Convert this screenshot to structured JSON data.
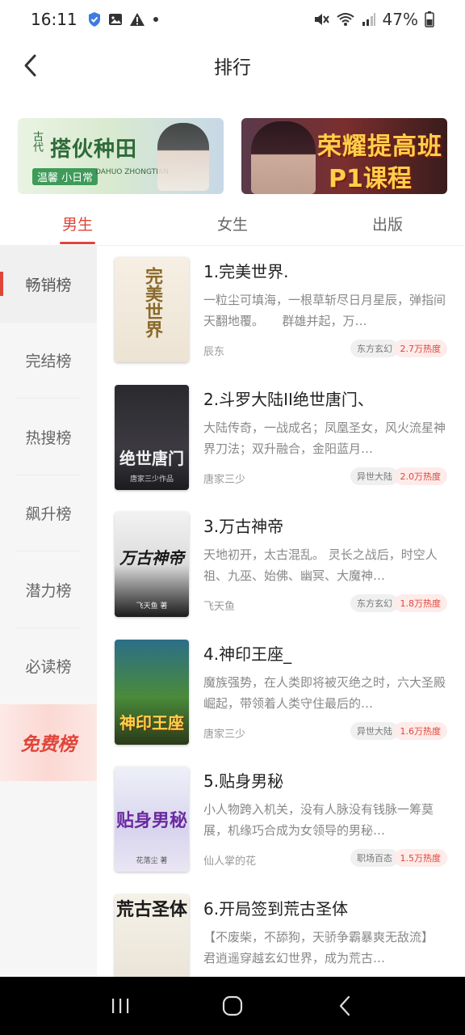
{
  "status_bar": {
    "time": "16:11",
    "battery": "47%",
    "left_icons": [
      "shield-icon",
      "image-icon",
      "warning-icon",
      "dot-icon"
    ],
    "right_icons": [
      "mute-icon",
      "wifi-icon",
      "signal-icon",
      "battery-icon"
    ]
  },
  "header": {
    "title": "排行",
    "back_icon": "chevron-left-icon"
  },
  "banners": [
    {
      "badge": "古代",
      "title": "搭伙种田",
      "tag": "温馨 小日常",
      "en": "DAHUO ZHONGTIAN"
    },
    {
      "title": "荣耀提高班",
      "subtitle": "P1课程"
    }
  ],
  "tabs": [
    {
      "label": "男生",
      "active": true
    },
    {
      "label": "女生",
      "active": false
    },
    {
      "label": "出版",
      "active": false
    }
  ],
  "sidebar": {
    "items": [
      {
        "label": "畅销榜",
        "active": true
      },
      {
        "label": "完结榜",
        "active": false
      },
      {
        "label": "热搜榜",
        "active": false
      },
      {
        "label": "飙升榜",
        "active": false
      },
      {
        "label": "潜力榜",
        "active": false
      },
      {
        "label": "必读榜",
        "active": false
      },
      {
        "label": "免费榜",
        "active": false,
        "highlight": true
      }
    ]
  },
  "books": [
    {
      "rank_title": "1.完美世界.",
      "description": "一粒尘可填海，一根草斩尽日月星辰，弹指间天翻地覆。　　群雄并起，万…",
      "author": "辰东",
      "genre": "东方玄幻",
      "heat": "2.7万热度",
      "cover_text": "完美世界"
    },
    {
      "rank_title": "2.斗罗大陆II绝世唐门、",
      "description": "大陆传奇，一战成名；凤凰圣女，风火流星神界刀法；双升融合，金阳蓝月…",
      "author": "唐家三少",
      "genre": "异世大陆",
      "heat": "2.0万热度",
      "cover_text": "绝世唐门",
      "cover_sub": "唐家三少作品"
    },
    {
      "rank_title": "3.万古神帝",
      "description": "天地初开，太古混乱。 灵长之战后，时空人祖、九巫、始佛、幽冥、大魔神…",
      "author": "飞天鱼",
      "genre": "东方玄幻",
      "heat": "1.8万热度",
      "cover_text": "万古神帝",
      "cover_sub": "飞天鱼 著"
    },
    {
      "rank_title": "4.神印王座_",
      "description": "魔族强势，在人类即将被灭绝之时，六大圣殿崛起，带领着人类守住最后的…",
      "author": "唐家三少",
      "genre": "异世大陆",
      "heat": "1.6万热度",
      "cover_text": "神印王座"
    },
    {
      "rank_title": "5.贴身男秘",
      "description": "小人物跨入机关，没有人脉没有钱脉一筹莫展，机缘巧合成为女领导的男秘…",
      "author": "仙人掌的花",
      "genre": "职场百态",
      "heat": "1.5万热度",
      "cover_text": "贴身男秘",
      "cover_sub": "花落尘 著"
    },
    {
      "rank_title": "6.开局签到荒古圣体",
      "description": "【不废柴，不舔狗，天骄争霸暴爽无敌流】 君逍遥穿越玄幻世界，成为荒古…",
      "author": "",
      "genre": "",
      "heat": "",
      "cover_text": "荒古圣体"
    }
  ],
  "nav": {
    "icons": [
      "recent-apps-icon",
      "home-icon",
      "back-icon"
    ]
  },
  "colors": {
    "accent": "#e0453a",
    "free_bg": "#fbd8d3",
    "navbar": "#000000"
  }
}
